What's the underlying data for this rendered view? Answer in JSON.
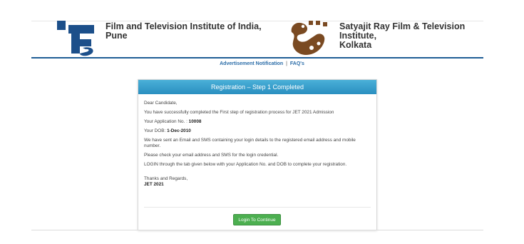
{
  "header": {
    "ftii": {
      "name_line1": "Film and Television Institute of India,",
      "name_line2": "Pune",
      "logo_icon": "ftii-logo-icon",
      "logo_color": "#1c4f8a"
    },
    "srfti": {
      "name_line1": "Satyajit Ray Film & Television Institute,",
      "name_line2": "Kolkata",
      "logo_icon": "srfti-logo-icon",
      "logo_color": "#7a4a22"
    }
  },
  "nav": {
    "advertisement_label": "Advertisement Notification",
    "separator": "|",
    "faq_label": "FAQ's"
  },
  "panel": {
    "title": "Registration – Step 1 Completed",
    "greeting": "Dear Candidate,",
    "line_success": "You have successfully completed the First step of registration process for JET 2021 Admission",
    "application_no_label": "Your Application No. :",
    "application_no_value": "10008",
    "dob_label": "Your DOB:",
    "dob_value": "1-Dec-2010",
    "line_email_sms": "We have sent an Email and SMS containing your login details to the registered email address and mobile number.",
    "line_check": "Please check your email address and SMS for the login credential.",
    "line_login": "LOGIN through the tab given below with your Application No. and DOB to complete your registration.",
    "thanks": "Thanks and Regards,",
    "signature": "JET 2021",
    "login_button": "Login To Continue"
  },
  "colors": {
    "header_rule": "#1f5e96",
    "panel_header": "#2a8fc0",
    "link": "#2a6ca8",
    "button": "#4caf50"
  }
}
